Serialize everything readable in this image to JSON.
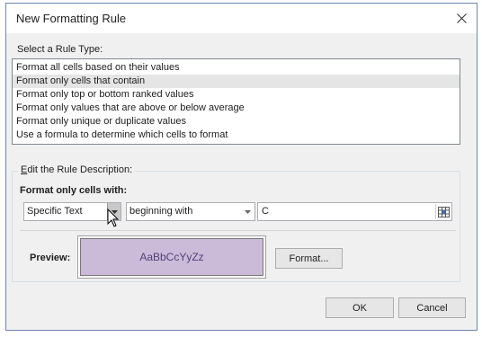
{
  "window": {
    "title": "New Formatting Rule"
  },
  "rule_type": {
    "label": "Select a Rule Type:",
    "items": [
      "Format all cells based on their values",
      "Format only cells that contain",
      "Format only top or bottom ranked values",
      "Format only values that are above or below average",
      "Format only unique or duplicate values",
      "Use a formula to determine which cells to format"
    ],
    "selected_index": 1
  },
  "description": {
    "group_label_prefix": "E",
    "group_label_rest": "dit the Rule Description:",
    "heading": "Format only cells with:",
    "condition_combo": {
      "value": "Specific Text"
    },
    "operator_combo": {
      "value": "beginning with"
    },
    "value_field": {
      "value": "C"
    }
  },
  "preview": {
    "label": "Preview:",
    "sample_text": "AaBbCcYyZz",
    "fill_color": "#cbbbd8",
    "text_color": "#52407a",
    "format_button": "Format..."
  },
  "buttons": {
    "ok": "OK",
    "cancel": "Cancel"
  }
}
